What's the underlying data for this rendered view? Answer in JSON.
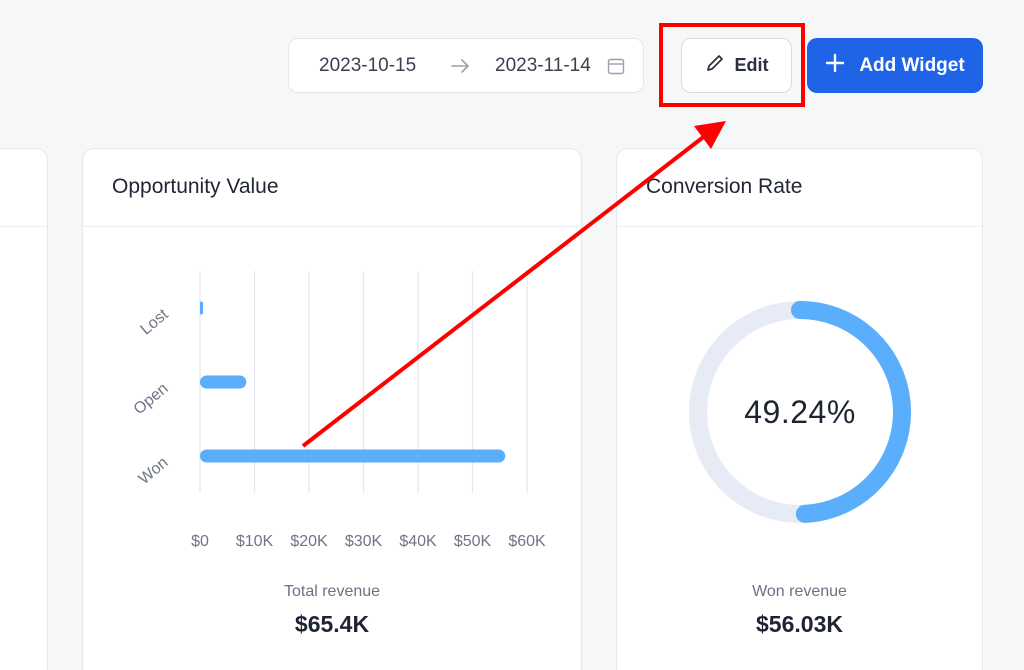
{
  "toolbar": {
    "date_start": "2023-10-15",
    "date_end": "2023-11-14",
    "edit_label": "Edit",
    "add_widget_label": "Add Widget",
    "icons": [
      "arrow-right-icon",
      "calendar-icon",
      "pencil-icon",
      "plus-icon"
    ]
  },
  "colors": {
    "accent": "#1f63e6",
    "bar": "#5aaefc",
    "donut_track": "#e6ebf5",
    "annotation": "#ff0000"
  },
  "opportunity_card": {
    "title": "Opportunity Value",
    "footer_label": "Total revenue",
    "footer_value": "$65.4K"
  },
  "conversion_card": {
    "title": "Conversion Rate",
    "percent_label": "49.24%",
    "percent_value": 49.24,
    "footer_label": "Won revenue",
    "footer_value": "$56.03K"
  },
  "chart_data": {
    "type": "bar",
    "orientation": "horizontal",
    "categories": [
      "Lost",
      "Open",
      "Won"
    ],
    "values": [
      0.3,
      8.5,
      56
    ],
    "x_ticks": [
      "$0",
      "$10K",
      "$20K",
      "$30K",
      "$40K",
      "$50K",
      "$60K"
    ],
    "xlim": [
      0,
      60
    ],
    "grid": true,
    "color": "#5aaefc"
  }
}
